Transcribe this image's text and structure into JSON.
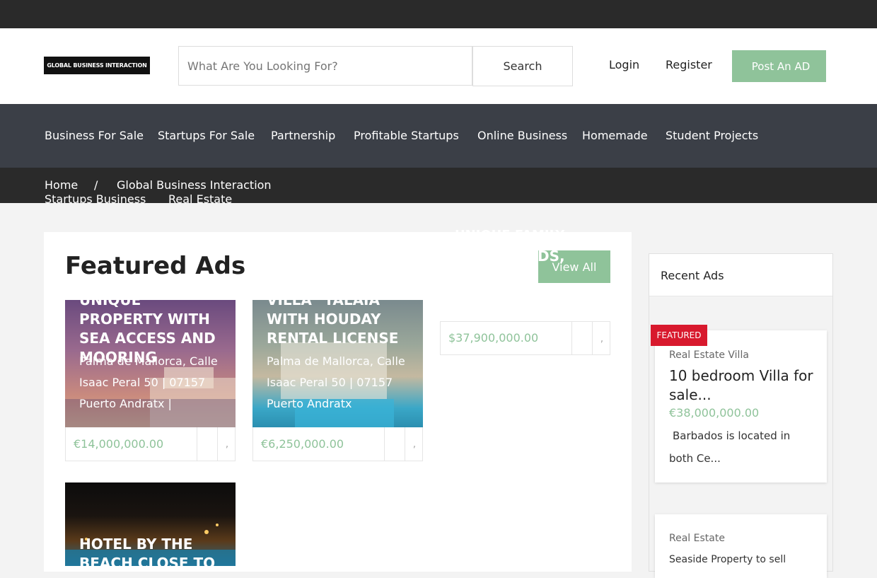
{
  "topbar": {
    "social_icons": [
      "facebook-icon",
      "twitter-icon",
      "linkedin-icon",
      "google-plus-icon",
      "youtube-icon",
      "instagram-icon"
    ],
    "icon_glyph": ""
  },
  "header": {
    "logo_text": "GLOBAL BUSINESS INTERACTION",
    "search_placeholder": "What Are You Looking For?",
    "search_label": "Search",
    "login_label": "Login",
    "register_label": "Register",
    "post_ad_label": "Post An AD",
    "icon_glyph": ""
  },
  "nav": {
    "items": [
      "Business For Sale",
      "Startups For Sale",
      "Partnership",
      "Profitable Startups",
      "Online Business",
      "Homemade",
      "Student Projects"
    ]
  },
  "breadcrumb": {
    "home": "Home",
    "separator": "/",
    "current": "Global Business Interaction",
    "sub1": "Startups Business",
    "sub2": "Real Estate"
  },
  "featured": {
    "title": "Featured Ads",
    "view_all": "View All",
    "ghost_line1": "UNIQUE FAMILY",
    "ghost_line2": "DS,",
    "ghost_icon": "",
    "cards": [
      {
        "title": "UNIQUE PROPERTY WITH SEA ACCESS AND MOORING",
        "address": "Palma de Mallorca, Calle Isaac Peral 50 | 07157 Puerto Andratx |",
        "price": "€14,000,000.00"
      },
      {
        "title": "VILLA \"TALAIA\" WITH HOUDAY RENTAL LICENSE",
        "address": "Palma de Mallorca, Calle Isaac Peral 50 | 07157 Puerto Andratx",
        "price": "€6,250,000.00"
      },
      {
        "title": "",
        "address": "",
        "price": "$37,900,000.00"
      },
      {
        "title": "HOTEL BY THE BEACH CLOSE TO CHANIA",
        "address": "",
        "price": ""
      }
    ],
    "card_icon_1": "",
    "card_icon_2": ","
  },
  "sidebar": {
    "title": "Recent Ads",
    "badge": "FEATURED",
    "items": [
      {
        "category": "Real Estate  Villa",
        "title": "10 bedroom Villa for sale...",
        "price": "€38,000,000.00",
        "excerpt": "Barbados is located in both Ce..."
      },
      {
        "category": "Real Estate",
        "title": "",
        "price": "",
        "excerpt": "Seaside Property to sell"
      }
    ]
  },
  "colors": {
    "accent": "#8fc39a",
    "dark": "#2a2a2a",
    "nav": "#3b3f47",
    "badge": "#d8192d"
  }
}
